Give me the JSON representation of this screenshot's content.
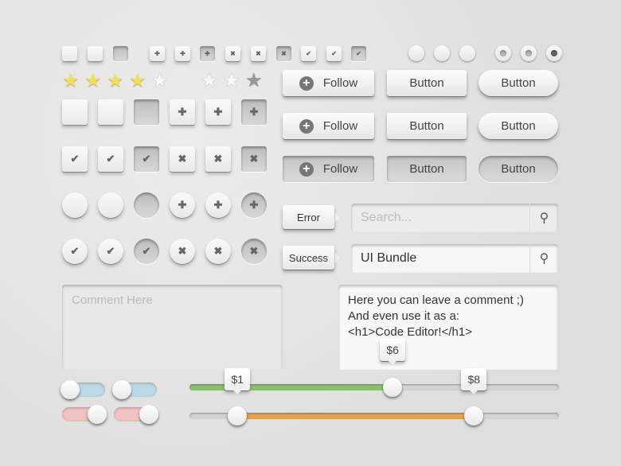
{
  "small_checkboxes": [
    "empty",
    "empty",
    "empty-pressed",
    "plus",
    "plus",
    "plus-pressed",
    "cross",
    "cross",
    "cross-pressed",
    "check",
    "check",
    "check-pressed"
  ],
  "radios": [
    "plain",
    "plain",
    "plain",
    "dot",
    "dot",
    "dot-selected"
  ],
  "rating_1": {
    "filled": 4,
    "total": 5
  },
  "rating_2": {
    "filled": 0,
    "total": 3,
    "hover_last": true
  },
  "big_square_rows": [
    [
      "empty",
      "empty",
      "empty-pressed",
      "plus",
      "plus",
      "plus-pressed"
    ],
    [
      "check",
      "check",
      "check-pressed",
      "cross",
      "cross",
      "cross-pressed"
    ]
  ],
  "big_round_rows": [
    [
      "empty",
      "empty",
      "empty-pressed",
      "plus",
      "plus",
      "plus-pressed"
    ],
    [
      "check",
      "check",
      "check-pressed",
      "cross",
      "cross",
      "cross-pressed"
    ]
  ],
  "buttons": {
    "follow": "Follow",
    "button": "Button",
    "states": [
      "normal",
      "hover",
      "pressed"
    ]
  },
  "tags": {
    "error": "Error",
    "success": "Success"
  },
  "search": {
    "placeholder": "Search...",
    "value": "UI Bundle"
  },
  "comment": {
    "placeholder": "Comment Here",
    "lines": [
      "Here you can leave a comment ;)",
      "And even use it as a:",
      "<h1>Code Editor!</h1>"
    ]
  },
  "toggles": [
    {
      "color": "#bcd9e6",
      "on": false
    },
    {
      "color": "#bcd9e6",
      "on": false
    },
    {
      "color": "#f0c2c2",
      "on": true
    },
    {
      "color": "#f0c2c2",
      "on": true
    }
  ],
  "slider_single": {
    "fill_color": "#8cbf6e",
    "value_pct": 55,
    "tooltip": "$6"
  },
  "slider_range": {
    "fill_color": "#e4a04f",
    "low_pct": 13,
    "high_pct": 77,
    "low_tooltip": "$1",
    "high_tooltip": "$8"
  }
}
